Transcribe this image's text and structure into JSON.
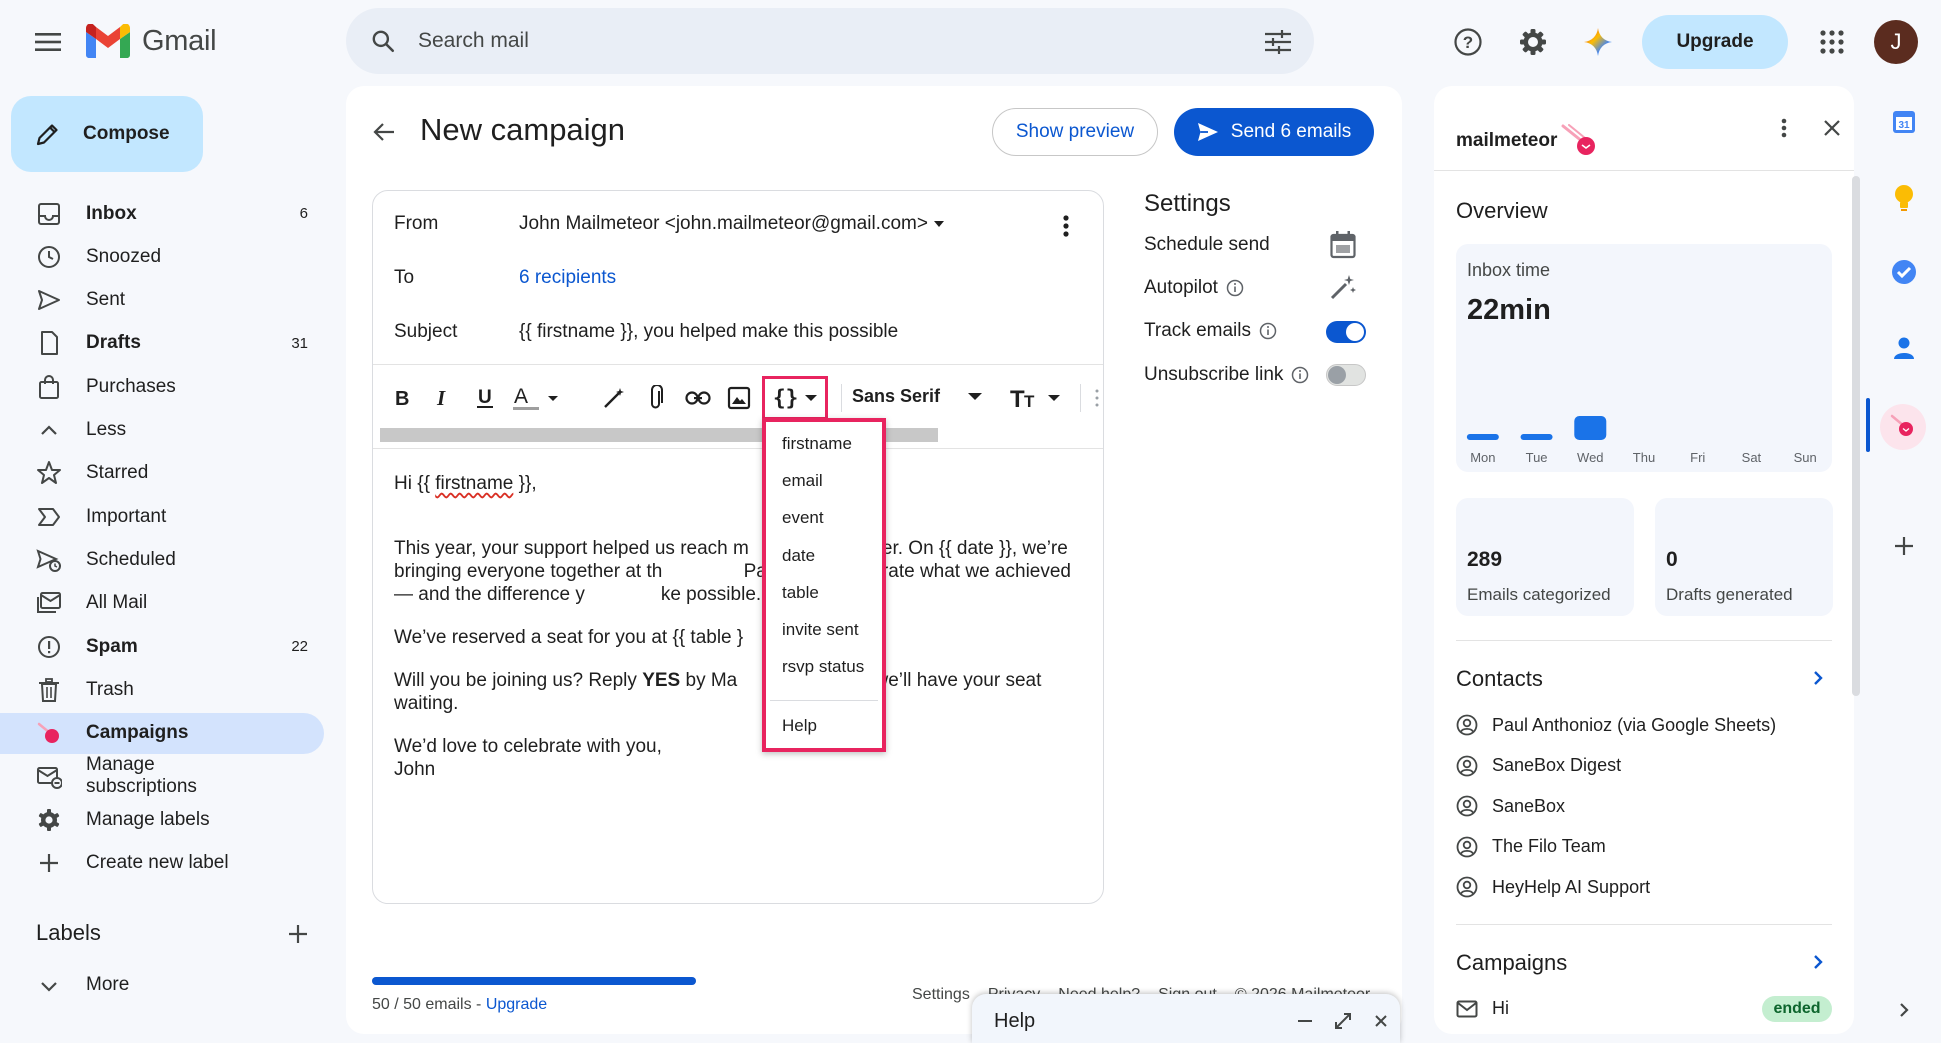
{
  "app": {
    "name": "Gmail"
  },
  "search": {
    "placeholder": "Search mail"
  },
  "header": {
    "upgrade_label": "Upgrade",
    "avatar_initial": "J"
  },
  "compose": {
    "label": "Compose"
  },
  "nav": [
    {
      "name": "inbox",
      "label": "Inbox",
      "count": "6",
      "bold": true,
      "icon": "inbox-icon"
    },
    {
      "name": "snoozed",
      "label": "Snoozed",
      "count": "",
      "icon": "clock-icon"
    },
    {
      "name": "sent",
      "label": "Sent",
      "count": "",
      "icon": "send-icon"
    },
    {
      "name": "drafts",
      "label": "Drafts",
      "count": "31",
      "bold": true,
      "icon": "draft-icon"
    },
    {
      "name": "purchases",
      "label": "Purchases",
      "count": "",
      "icon": "shopping-bag-icon"
    },
    {
      "name": "less",
      "label": "Less",
      "count": "",
      "icon": "chevron-up-icon"
    },
    {
      "name": "starred",
      "label": "Starred",
      "count": "",
      "icon": "star-icon"
    },
    {
      "name": "important",
      "label": "Important",
      "count": "",
      "icon": "label-important-icon"
    },
    {
      "name": "scheduled",
      "label": "Scheduled",
      "count": "",
      "icon": "scheduled-send-icon"
    },
    {
      "name": "all-mail",
      "label": "All Mail",
      "count": "",
      "icon": "all-mail-icon"
    },
    {
      "name": "spam",
      "label": "Spam",
      "count": "22",
      "bold": true,
      "icon": "spam-icon"
    },
    {
      "name": "trash",
      "label": "Trash",
      "count": "",
      "icon": "trash-icon"
    },
    {
      "name": "campaigns",
      "label": "Campaigns",
      "count": "",
      "bold": true,
      "active": true,
      "icon": "mailmeteor-icon"
    },
    {
      "name": "manage-subscriptions",
      "label": "Manage subscriptions",
      "count": "",
      "icon": "unsubscribe-icon"
    },
    {
      "name": "manage-labels",
      "label": "Manage labels",
      "count": "",
      "icon": "gear-icon"
    },
    {
      "name": "create-new-label",
      "label": "Create new label",
      "count": "",
      "icon": "plus-icon"
    }
  ],
  "labels": {
    "title": "Labels",
    "more_label": "More"
  },
  "campaign": {
    "title": "New campaign",
    "show_preview": "Show preview",
    "send_label": "Send 6 emails",
    "from_label": "From",
    "from_value": "John Mailmeteor <john.mailmeteor@gmail.com>",
    "to_label": "To",
    "to_value": "6 recipients",
    "subject_label": "Subject",
    "subject_value": "{{ firstname }}, you helped make this possible",
    "font_name": "Sans Serif",
    "body": {
      "greeting_pre": "Hi {{ ",
      "greeting_var": "firstname",
      "greeting_post": " }},",
      "p1": "This year, your support helped us reach m    han ever. On {{ date }}, we’re bringing everyone together at th     Pavilion to celebrate what we achieved — and the difference y    ke possible.",
      "p2": "We’ve reserved a seat for you at {{ table }",
      "p3_pre": "Will you be joining us? Reply ",
      "p3_bold": "YES",
      "p3_post": " by Ma      and we’ll have your seat waiting.",
      "p4a": "We’d love to celebrate with you,",
      "p4b": "John"
    }
  },
  "variables_menu": {
    "items": [
      "firstname",
      "email",
      "event",
      "date",
      "table",
      "invite sent",
      "rsvp status"
    ],
    "help": "Help"
  },
  "settings": {
    "title": "Settings",
    "schedule_send": "Schedule send",
    "autopilot": "Autopilot",
    "track_emails": "Track emails",
    "track_emails_on": true,
    "unsubscribe_link": "Unsubscribe link",
    "unsubscribe_on": false
  },
  "quota": {
    "text": "50 / 50 emails - ",
    "upgrade": "Upgrade",
    "fraction": 1.0
  },
  "footer": {
    "links": [
      "Settings",
      "Privacy",
      "Need help?",
      "Sign out",
      "© 2026 Mailmeteor"
    ]
  },
  "help_window": {
    "title": "Help"
  },
  "mailmeteor": {
    "logo_text": "mailmeteor",
    "overview_title": "Overview",
    "inbox_time_label": "Inbox time",
    "inbox_time_value": "22min",
    "chart_days": [
      "Mon",
      "Tue",
      "Wed",
      "Thu",
      "Fri",
      "Sat",
      "Sun"
    ],
    "chart_values": [
      1,
      1,
      3,
      0,
      0,
      0,
      0
    ],
    "emails_categorized": "289",
    "emails_categorized_label": "Emails categorized",
    "drafts_generated": "0",
    "drafts_generated_label": "Drafts generated",
    "contacts_title": "Contacts",
    "contacts": [
      "Paul Anthonioz (via Google Sheets)",
      "SaneBox Digest",
      "SaneBox",
      "The Filo Team",
      "HeyHelp AI Support"
    ],
    "campaigns_title": "Campaigns",
    "campaign_name": "Hi",
    "campaign_status": "ended"
  },
  "colors": {
    "accent": "#0b57d0",
    "highlight": "#e8245f",
    "active_nav": "#d3e3fd",
    "compose_bg": "#c2e7ff"
  }
}
